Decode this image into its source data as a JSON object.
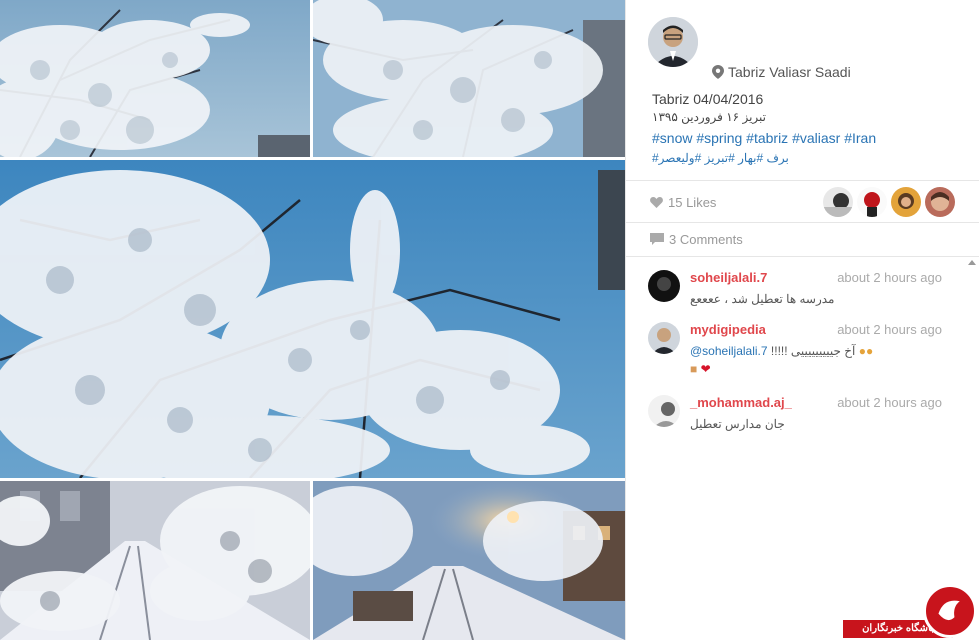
{
  "post": {
    "location": "Tabriz Valiasr Saadi",
    "title": "Tabriz 04/04/2016",
    "title_persian": "تبریز ۱۶ فروردین ۱۳۹۵",
    "hashtags_en": "#snow #spring #tabriz #valiasr #Iran",
    "hashtags_fa": "برف #بهار #تبریز #ولیعصر#",
    "likes": "15 Likes",
    "comments_count": "3 Comments"
  },
  "comments": [
    {
      "user": "soheiljalali.7",
      "time": "about 2 hours ago",
      "text": "مدرسه ها تعطیل شد ، ععععع"
    },
    {
      "user": "mydigipedia",
      "time": "about 2 hours ago",
      "mention": "@soheiljalali.7",
      "text": "!!!!! آخ جیییییییییی"
    },
    {
      "user": "_mohammad.aj_",
      "time": "about 2 hours ago",
      "text": "جان مدارس تعطیل"
    }
  ],
  "watermark": {
    "text": "باشگاه خبرنگاران"
  },
  "colors": {
    "accent_link": "#2a74b4",
    "username": "#e0474c",
    "watermark": "#c8141c"
  },
  "icons": {
    "location": "map-pin-icon",
    "likes": "heart-icon",
    "comments": "speech-bubble-icon"
  }
}
